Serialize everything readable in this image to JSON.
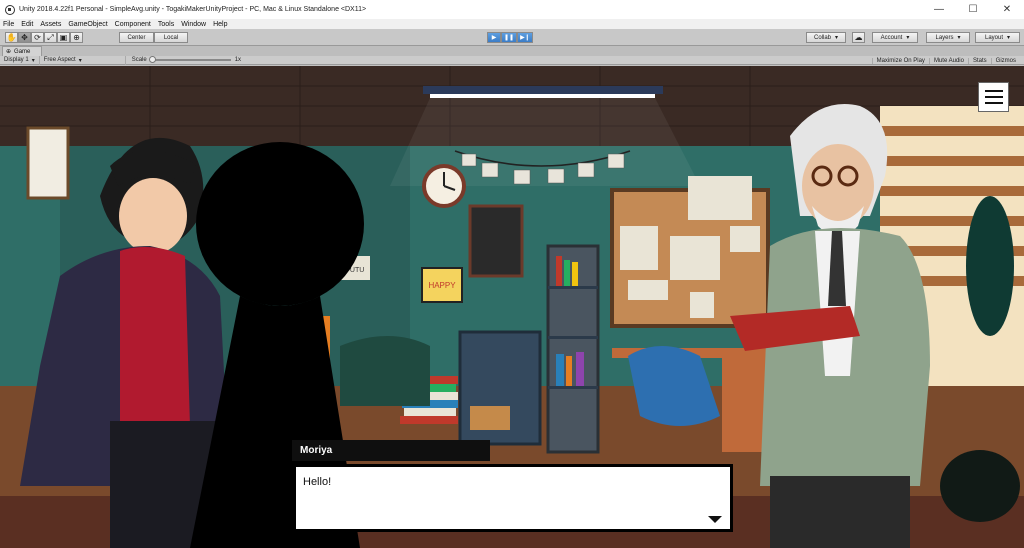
{
  "window": {
    "title": "Unity 2018.4.22f1 Personal - SimpleAvg.unity - TogakiMakerUnityProject - PC, Mac & Linux Standalone <DX11>",
    "controls": {
      "minimize": "—",
      "maximize": "☐",
      "close": "✕"
    }
  },
  "menu": [
    "File",
    "Edit",
    "Assets",
    "GameObject",
    "Component",
    "Tools",
    "Window",
    "Help"
  ],
  "toolbar": {
    "tools": [
      "✋",
      "✥",
      "⟳",
      "⤢",
      "▣",
      "⊕"
    ],
    "center_label": "Center",
    "local_label": "Local",
    "play": "▶",
    "pause": "❚❚",
    "step": "▶❙",
    "collab_label": "Collab",
    "cloud": "☁",
    "account_label": "Account",
    "layers_label": "Layers",
    "layout_label": "Layout"
  },
  "game_tab": {
    "label": "Game",
    "icon": "game-icon"
  },
  "game_bar": {
    "display": "Display 1",
    "aspect": "Free Aspect",
    "scale_label": "Scale",
    "scale_value": "1x",
    "maximize": "Maximize On Play",
    "mute": "Mute Audio",
    "stats": "Stats",
    "gizmos": "Gizmos"
  },
  "scene": {
    "speaker": "Moriya",
    "dialog_text": "Hello!",
    "poster_text": "HAPPY",
    "wall_sign": "FUTU"
  },
  "colors": {
    "wall": "#2f6e67",
    "ceiling": "#3a2a24",
    "floor": "#7a4a2c",
    "cork": "#c48a55",
    "hoodie": "#b11a2f",
    "coat": "#8fa38c"
  }
}
